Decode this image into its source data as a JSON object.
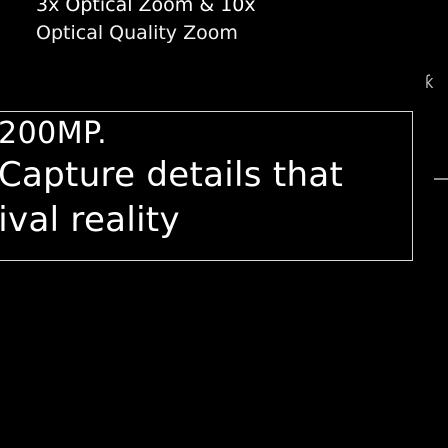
{
  "caption": {
    "line1": "3x Optical Zoom & 10x",
    "line2": "Optical Quality Zoom"
  },
  "edge_glyph": "ƙ",
  "headline": {
    "line1": "200MP.",
    "line2": "Capture details that",
    "line3": "rival reality"
  }
}
